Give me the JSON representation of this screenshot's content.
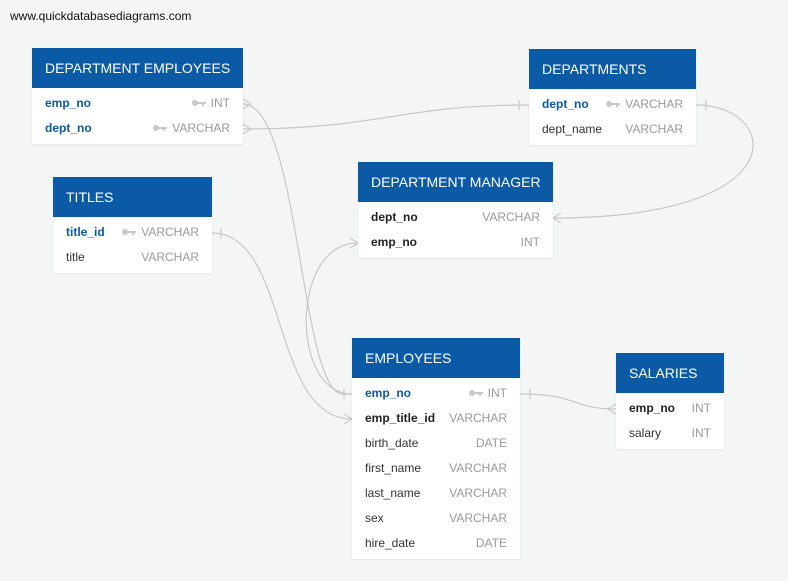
{
  "watermark": "www.quickdatabasediagrams.com",
  "colors": {
    "header": "#0b5aa6",
    "pk_text": "#0b5aa6",
    "type_text": "#9a9a9a",
    "line": "#c8c8c8"
  },
  "tables": {
    "dept_emp": {
      "title": "DEPARTMENT EMPLOYEES",
      "rows": [
        {
          "name": "emp_no",
          "type": "INT",
          "key": true
        },
        {
          "name": "dept_no",
          "type": "VARCHAR",
          "key": true
        }
      ]
    },
    "departments": {
      "title": "DEPARTMENTS",
      "rows": [
        {
          "name": "dept_no",
          "type": "VARCHAR",
          "key": true
        },
        {
          "name": "dept_name",
          "type": "VARCHAR",
          "key": false
        }
      ]
    },
    "titles": {
      "title": "TITLES",
      "rows": [
        {
          "name": "title_id",
          "type": "VARCHAR",
          "key": true
        },
        {
          "name": "title",
          "type": "VARCHAR",
          "key": false
        }
      ]
    },
    "dept_manager": {
      "title": "DEPARTMENT MANAGER",
      "rows": [
        {
          "name": "dept_no",
          "type": "VARCHAR",
          "key": false
        },
        {
          "name": "emp_no",
          "type": "INT",
          "key": false
        }
      ]
    },
    "employees": {
      "title": "EMPLOYEES",
      "rows": [
        {
          "name": "emp_no",
          "type": "INT",
          "key": true
        },
        {
          "name": "emp_title_id",
          "type": "VARCHAR",
          "key": false
        },
        {
          "name": "birth_date",
          "type": "DATE",
          "key": false
        },
        {
          "name": "first_name",
          "type": "VARCHAR",
          "key": false
        },
        {
          "name": "last_name",
          "type": "VARCHAR",
          "key": false
        },
        {
          "name": "sex",
          "type": "VARCHAR",
          "key": false
        },
        {
          "name": "hire_date",
          "type": "DATE",
          "key": false
        }
      ]
    },
    "salaries": {
      "title": "SALARIES",
      "rows": [
        {
          "name": "emp_no",
          "type": "INT",
          "key": false
        },
        {
          "name": "salary",
          "type": "INT",
          "key": false
        }
      ]
    }
  }
}
